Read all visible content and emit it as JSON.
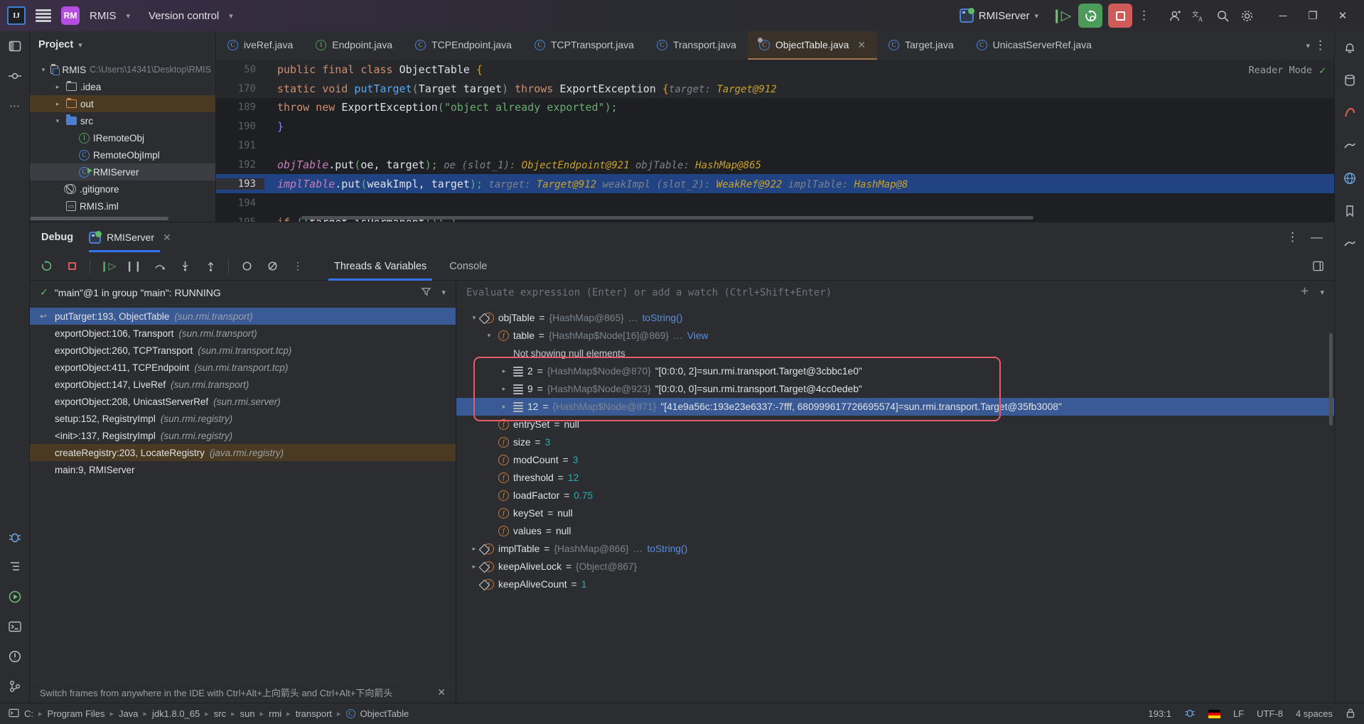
{
  "titlebar": {
    "ide_logo": "IJ",
    "menu_icon": "hamburger-menu-icon",
    "project_badge": "RM",
    "project_name": "RMIS",
    "version_control": "Version control",
    "run_config": "RMIServer",
    "debug_icon": "debug-step-icon",
    "rerun_icon": "rerun-debug-icon",
    "stop_icon": "stop-icon",
    "more_icon": "more-vertical-icon",
    "account_icon": "account-icon",
    "translate_icon": "translate-icon",
    "search_icon": "search-icon",
    "settings_icon": "settings-gear-icon",
    "minimize": "─",
    "maximize": "❐",
    "close": "✕"
  },
  "project_panel": {
    "title": "Project",
    "items": [
      {
        "label": "RMIS",
        "path": "C:\\Users\\14341\\Desktop\\RMIS",
        "icon": "module-folder-icon",
        "indent": 0,
        "arrow": "down",
        "state": "normal"
      },
      {
        "label": ".idea",
        "path": "",
        "icon": "folder-gray-icon",
        "indent": 1,
        "arrow": "right",
        "state": "normal"
      },
      {
        "label": "out",
        "path": "",
        "icon": "folder-orange-icon",
        "indent": 1,
        "arrow": "right",
        "state": "highlight"
      },
      {
        "label": "src",
        "path": "",
        "icon": "folder-blue-icon",
        "indent": 1,
        "arrow": "down",
        "state": "normal"
      },
      {
        "label": "IRemoteObj",
        "path": "",
        "icon": "interface-icon",
        "indent": 2,
        "arrow": "none",
        "state": "normal"
      },
      {
        "label": "RemoteObjImpl",
        "path": "",
        "icon": "class-icon",
        "indent": 2,
        "arrow": "none",
        "state": "normal"
      },
      {
        "label": "RMIServer",
        "path": "",
        "icon": "runnable-class-icon",
        "indent": 2,
        "arrow": "none",
        "state": "selected"
      },
      {
        "label": ".gitignore",
        "path": "",
        "icon": "gitignore-icon",
        "indent": 1,
        "arrow": "none",
        "state": "normal"
      },
      {
        "label": "RMIS.iml",
        "path": "",
        "icon": "iml-file-icon",
        "indent": 1,
        "arrow": "none",
        "state": "normal"
      }
    ]
  },
  "editor": {
    "tabs": [
      {
        "label": "iveRef.java",
        "icon": "class-icon",
        "active": false,
        "clipped": true
      },
      {
        "label": "Endpoint.java",
        "icon": "interface-icon",
        "active": false
      },
      {
        "label": "TCPEndpoint.java",
        "icon": "class-icon",
        "active": false
      },
      {
        "label": "TCPTransport.java",
        "icon": "class-icon",
        "active": false
      },
      {
        "label": "Transport.java",
        "icon": "class-icon",
        "active": false
      },
      {
        "label": "ObjectTable.java",
        "icon": "class-icon",
        "active": true
      },
      {
        "label": "Target.java",
        "icon": "class-icon",
        "active": false
      },
      {
        "label": "UnicastServerRef.java",
        "icon": "class-icon",
        "active": false
      }
    ],
    "tab_overflow_icon": "chevron-down-icon",
    "tab_more_icon": "more-vertical-icon",
    "reader_mode": "Reader Mode",
    "inspection_ok": "✓",
    "sticky_lines": [
      {
        "num": "50",
        "segments": [
          {
            "t": "public ",
            "c": "kw"
          },
          {
            "t": "final ",
            "c": "kw"
          },
          {
            "t": "class ",
            "c": "kw"
          },
          {
            "t": "ObjectTable ",
            "c": "ty"
          },
          {
            "t": "{",
            "c": "brace"
          }
        ]
      },
      {
        "num": "170",
        "segments": [
          {
            "t": "    static ",
            "c": "kw"
          },
          {
            "t": "void ",
            "c": "kw"
          },
          {
            "t": "putTarget",
            "c": "fn"
          },
          {
            "t": "(",
            "c": "par"
          },
          {
            "t": "Target target",
            "c": "pn"
          },
          {
            "t": ") ",
            "c": "par"
          },
          {
            "t": "throws ",
            "c": "kw"
          },
          {
            "t": "ExportException ",
            "c": "ty"
          },
          {
            "t": "{",
            "c": "brace"
          }
        ],
        "hint": "target: ",
        "hint_value": "Target@912"
      }
    ],
    "code_lines": [
      {
        "num": "189",
        "partial": true,
        "segments": [
          {
            "t": "            throw new ",
            "c": "kw"
          },
          {
            "t": "ExportException",
            "c": "ty"
          },
          {
            "t": "(",
            "c": "par"
          },
          {
            "t": "\"object already exported\"",
            "c": "str"
          },
          {
            "t": ");",
            "c": "par"
          }
        ]
      },
      {
        "num": "190",
        "segments": [
          {
            "t": "        }",
            "c": "brace2"
          }
        ]
      },
      {
        "num": "191",
        "segments": [
          {
            "t": "",
            "c": "pn"
          }
        ]
      },
      {
        "num": "192",
        "segments": [
          {
            "t": "        objTable",
            "c": "pl"
          },
          {
            "t": ".put",
            "c": "pn"
          },
          {
            "t": "(",
            "c": "par"
          },
          {
            "t": "oe, target",
            "c": "pn"
          },
          {
            "t": ");",
            "c": "par"
          }
        ],
        "hints": [
          {
            "label": "  oe (slot_1): ",
            "value": "ObjectEndpoint@921"
          },
          {
            "label": "   objTable: ",
            "value": "HashMap@865"
          }
        ]
      },
      {
        "num": "193",
        "highlight": true,
        "segments": [
          {
            "t": "        implTable",
            "c": "pl"
          },
          {
            "t": ".put",
            "c": "pn"
          },
          {
            "t": "(",
            "c": "par"
          },
          {
            "t": "weakImpl, target",
            "c": "pn"
          },
          {
            "t": ");",
            "c": "par"
          }
        ],
        "hints": [
          {
            "label": "  target: ",
            "value": "Target@912"
          },
          {
            "label": "   weakImpl (slot_2): ",
            "value": "WeakRef@922"
          },
          {
            "label": "   implTable: ",
            "value": "HashMap@8"
          }
        ]
      },
      {
        "num": "194",
        "segments": [
          {
            "t": "",
            "c": "pn"
          }
        ]
      },
      {
        "num": "195",
        "partial": true,
        "segments": [
          {
            "t": "        if ",
            "c": "kw"
          },
          {
            "t": "(!",
            "c": "par"
          },
          {
            "t": "target.isPermanent",
            "c": "pn"
          },
          {
            "t": "()) {",
            "c": "par"
          }
        ]
      }
    ]
  },
  "debug_panel": {
    "title": "Debug",
    "session_tab": "RMIServer",
    "session_close": "✕",
    "more_icon": "more-vertical-icon",
    "minimize_icon": "minimize-icon",
    "toolbar": {
      "rerun_icon": "rerun-icon",
      "stop_icon": "stop-icon",
      "resume_icon": "resume-program-icon",
      "pause_icon": "pause-program-icon",
      "step_over_icon": "step-over-icon",
      "step_into_icon": "step-into-icon",
      "step_out_icon": "step-out-icon",
      "mute_breakpoints_icon": "mute-breakpoints-icon",
      "view_breakpoints_icon": "view-breakpoints-icon",
      "more_icon": "more-vertical-icon",
      "layout_icon": "layout-settings-icon"
    },
    "tabs": [
      {
        "label": "Threads & Variables",
        "active": true
      },
      {
        "label": "Console",
        "active": false
      }
    ],
    "thread_status": "\"main\"@1 in group \"main\": RUNNING",
    "thread_check_icon": "check-icon",
    "filter_icon": "filter-icon",
    "thread_chevron_icon": "chevron-down-icon",
    "frames": [
      {
        "method": "putTarget:193, ObjectTable",
        "pkg": "(sun.rmi.transport)",
        "state": "selected"
      },
      {
        "method": "exportObject:106, Transport",
        "pkg": "(sun.rmi.transport)",
        "state": "normal"
      },
      {
        "method": "exportObject:260, TCPTransport",
        "pkg": "(sun.rmi.transport.tcp)",
        "state": "normal"
      },
      {
        "method": "exportObject:411, TCPEndpoint",
        "pkg": "(sun.rmi.transport.tcp)",
        "state": "normal"
      },
      {
        "method": "exportObject:147, LiveRef",
        "pkg": "(sun.rmi.transport)",
        "state": "normal"
      },
      {
        "method": "exportObject:208, UnicastServerRef",
        "pkg": "(sun.rmi.server)",
        "state": "normal"
      },
      {
        "method": "setup:152, RegistryImpl",
        "pkg": "(sun.rmi.registry)",
        "state": "normal"
      },
      {
        "method": "<init>:137, RegistryImpl",
        "pkg": "(sun.rmi.registry)",
        "state": "normal"
      },
      {
        "method": "createRegistry:203, LocateRegistry",
        "pkg": "(java.rmi.registry)",
        "state": "highlight"
      },
      {
        "method": "main:9, RMIServer",
        "pkg": "",
        "state": "normal"
      }
    ],
    "frames_hint": "Switch frames from anywhere in the IDE with Ctrl+Alt+上向箭头 and Ctrl+Alt+下向箭头",
    "frames_hint_close": "✕",
    "evaluate_placeholder": "Evaluate expression (Enter) or add a watch (Ctrl+Shift+Enter)",
    "eval_add_icon": "add-watch-icon",
    "eval_chevron_icon": "chevron-down-icon",
    "variables": [
      {
        "indent": 0,
        "arrow": "down",
        "icon": "object-field-icon",
        "name": "objTable",
        "eq": " = ",
        "type": "{HashMap@865}",
        "extra": " … ",
        "link": "toString()",
        "state": "normal"
      },
      {
        "indent": 1,
        "arrow": "down",
        "icon": "field-icon",
        "name": "table",
        "eq": " = ",
        "type": "{HashMap$Node[16]@869}",
        "extra": " … ",
        "link": "View",
        "state": "normal"
      },
      {
        "indent": 2,
        "arrow": "none",
        "icon": "none",
        "name": "",
        "note": "Not showing null elements",
        "state": "normal"
      },
      {
        "indent": 2,
        "arrow": "right",
        "icon": "node-icon",
        "name": "2",
        "eq": " = ",
        "type": "{HashMap$Node@870}",
        "value": "\"[0:0:0, 2]=sun.rmi.transport.Target@3cbbc1e0\"",
        "state": "normal"
      },
      {
        "indent": 2,
        "arrow": "right",
        "icon": "node-icon",
        "name": "9",
        "eq": " = ",
        "type": "{HashMap$Node@923}",
        "value": "\"[0:0:0, 0]=sun.rmi.transport.Target@4cc0edeb\"",
        "state": "normal"
      },
      {
        "indent": 2,
        "arrow": "right",
        "icon": "node-icon",
        "name": "12",
        "eq": " = ",
        "type": "{HashMap$Node@871}",
        "value": "\"[41e9a56c:193e23e6337:-7fff, 680999617726695574]=sun.rmi.transport.Target@35fb3008\"",
        "state": "selected"
      },
      {
        "indent": 1,
        "arrow": "none",
        "icon": "field-icon",
        "name": "entrySet",
        "eq": " = ",
        "value_plain": "null",
        "state": "normal"
      },
      {
        "indent": 1,
        "arrow": "none",
        "icon": "field-icon",
        "name": "size",
        "eq": " = ",
        "value_plain": "3",
        "num": true,
        "state": "normal"
      },
      {
        "indent": 1,
        "arrow": "none",
        "icon": "field-icon",
        "name": "modCount",
        "eq": " = ",
        "value_plain": "3",
        "num": true,
        "state": "normal"
      },
      {
        "indent": 1,
        "arrow": "none",
        "icon": "field-icon",
        "name": "threshold",
        "eq": " = ",
        "value_plain": "12",
        "num": true,
        "state": "normal"
      },
      {
        "indent": 1,
        "arrow": "none",
        "icon": "field-icon",
        "name": "loadFactor",
        "eq": " = ",
        "value_plain": "0.75",
        "num": true,
        "state": "normal"
      },
      {
        "indent": 1,
        "arrow": "none",
        "icon": "field-icon",
        "name": "keySet",
        "eq": " = ",
        "value_plain": "null",
        "state": "normal"
      },
      {
        "indent": 1,
        "arrow": "none",
        "icon": "field-icon",
        "name": "values",
        "eq": " = ",
        "value_plain": "null",
        "state": "normal"
      },
      {
        "indent": 0,
        "arrow": "right",
        "icon": "object-field-icon",
        "name": "implTable",
        "eq": " = ",
        "type": "{HashMap@866}",
        "extra": " … ",
        "link": "toString()",
        "state": "normal"
      },
      {
        "indent": 0,
        "arrow": "right",
        "icon": "object-field-icon",
        "name": "keepAliveLock",
        "eq": " = ",
        "type": "{Object@867}",
        "state": "normal"
      },
      {
        "indent": 0,
        "arrow": "none",
        "icon": "object-field-icon",
        "name": "keepAliveCount",
        "eq": " = ",
        "value_plain": "1",
        "num": true,
        "state": "normal"
      }
    ]
  },
  "status_bar": {
    "terminal_icon": "terminal-icon",
    "breadcrumb": [
      "C:",
      "Program Files",
      "Java",
      "jdk1.8.0_65",
      "src",
      "sun",
      "rmi",
      "transport",
      "ObjectTable"
    ],
    "breadcrumb_last_icon": "class-icon",
    "caret": "193:1",
    "line_sep": "LF",
    "encoding": "UTF-8",
    "indent": "4 spaces",
    "lock_icon": "lock-icon",
    "bug_icon": "bug-icon",
    "keyboard_flag_cn": "cn-flag-icon",
    "keyboard_flag_de": "de-flag-icon"
  },
  "left_tools": [
    "project-icon",
    "commit-icon",
    "more-tools-icon",
    "debug-icon",
    "structure-icon",
    "run-icon",
    "terminal-icon",
    "problems-icon",
    "version-control-icon"
  ],
  "right_tools": [
    "notifications-icon",
    "database-icon",
    "maven-icon",
    "gradle-icon",
    "web-icon",
    "bookmarks-icon",
    "plugins-icon"
  ],
  "colors": {
    "accent_blue": "#3574f0",
    "selection_blue": "#214283",
    "red_annotation": "#e8596b",
    "green_run": "#4c9b5a",
    "red_stop": "#cf5a5a",
    "highlight_brown": "#4a3a22"
  }
}
